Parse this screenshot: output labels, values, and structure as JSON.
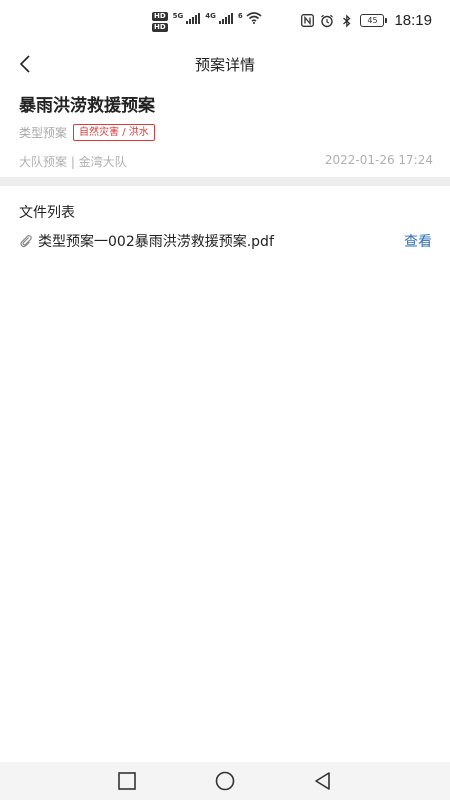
{
  "status_bar": {
    "sim1_badge": "HD",
    "sim2_badge": "HD",
    "net1": "5G",
    "net2": "4G",
    "wifi_badge": "6",
    "battery": "45",
    "time": "18:19",
    "icons": [
      "nfc-icon",
      "alarm-icon",
      "bluetooth-icon",
      "battery-icon"
    ]
  },
  "header": {
    "title": "预案详情",
    "back_icon": "chevron-left-icon"
  },
  "plan": {
    "title": "暴雨洪涝救援预案",
    "type_label": "类型预案",
    "type_tag": "自然灾害 / 洪水",
    "source": "大队预案 | 金湾大队",
    "date": "2022-01-26 17:24",
    "tag_color": "#d73b3b"
  },
  "files": {
    "section_title": "文件列表",
    "items": [
      {
        "name": "类型预案一002暴雨洪涝救援预案.pdf",
        "action": "查看"
      }
    ],
    "link_color": "#2e6fb3"
  },
  "nav": {
    "buttons": [
      "recent-apps-icon",
      "home-icon",
      "back-triangle-icon"
    ]
  }
}
